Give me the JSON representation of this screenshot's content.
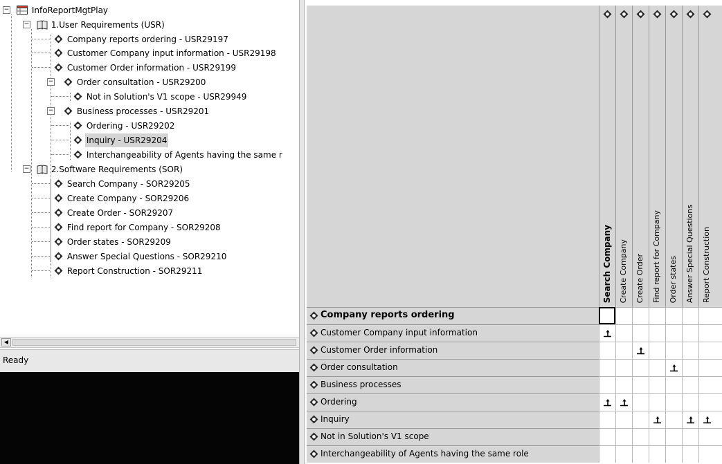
{
  "tree": {
    "root": "InfoReportMgtPlay",
    "usr_group": "1.User Requirements (USR)",
    "usr_items": [
      "Company reports ordering - USR29197",
      "Customer Company input information - USR29198",
      "Customer Order information - USR29199",
      "Order consultation - USR29200",
      "Not in Solution's V1 scope - USR29949",
      "Business processes - USR29201",
      "Ordering - USR29202",
      "Inquiry - USR29204",
      "Interchangeability of Agents having the same r"
    ],
    "sor_group": "2.Software Requirements (SOR)",
    "sor_items": [
      "Search Company - SOR29205",
      "Create Company - SOR29206",
      "Create Order - SOR29207",
      "Find report for Company - SOR29208",
      "Order states - SOR29209",
      "Answer Special Questions - SOR29210",
      "Report Construction - SOR29211"
    ]
  },
  "status": {
    "text": "Ready"
  },
  "matrix": {
    "columns": [
      "Search Company",
      "Create Company",
      "Create Order",
      "Find report for Company",
      "Order states",
      "Answer Special Questions",
      "Report Construction"
    ],
    "rows": [
      "Company reports ordering",
      "Customer Company input information",
      "Customer Order information",
      "Order consultation",
      "Business processes",
      "Ordering",
      "Inquiry",
      "Not in Solution's V1 scope",
      "Interchangeability of Agents having the same role"
    ]
  },
  "icons": {
    "requirement": "requirement-diamond-icon",
    "folder": "requirements-book-icon",
    "project": "project-grid-icon",
    "trace_mark": "trace-link-arrow-icon"
  },
  "colors": {
    "diamond": "#2b2b2b",
    "header_bg": "#d6d6d6",
    "selection": "#d4d4d4",
    "console": "#050505"
  }
}
